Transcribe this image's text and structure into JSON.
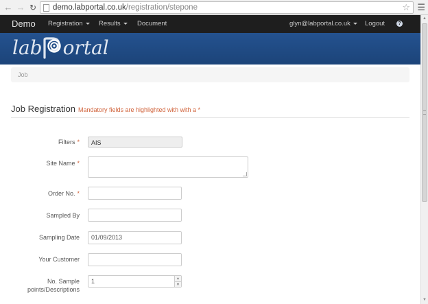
{
  "browser": {
    "url_host": "demo.labportal.co.uk",
    "url_path": "/registration/stepone"
  },
  "navbar": {
    "brand": "Demo",
    "items": [
      {
        "label": "Registration",
        "dropdown": true
      },
      {
        "label": "Results",
        "dropdown": true
      },
      {
        "label": "Document",
        "dropdown": false
      }
    ],
    "user": "glyn@labportal.co.uk",
    "logout": "Logout"
  },
  "banner": {
    "logo_part1": "lab",
    "logo_part2": "ortal",
    "bg_color": "#1f4a85"
  },
  "breadcrumb": {
    "current": "Job"
  },
  "page": {
    "title": "Job Registration",
    "note": "Mandatory fields are highlighted with with a *",
    "accent_color": "#d0623a"
  },
  "form": {
    "filters": {
      "label": "Filters",
      "required": "*",
      "value": "AIS"
    },
    "site_name": {
      "label": "Site Name",
      "required": "*",
      "value": ""
    },
    "order_no": {
      "label": "Order No.",
      "required": "*",
      "value": ""
    },
    "sampled_by": {
      "label": "Sampled By",
      "value": ""
    },
    "sampling_date": {
      "label": "Sampling Date",
      "value": "01/09/2013"
    },
    "your_customer": {
      "label": "Your Customer",
      "value": ""
    },
    "sample_points": {
      "label_line1": "No. Sample",
      "label_line2": "points/Descriptions",
      "value": "1"
    }
  }
}
